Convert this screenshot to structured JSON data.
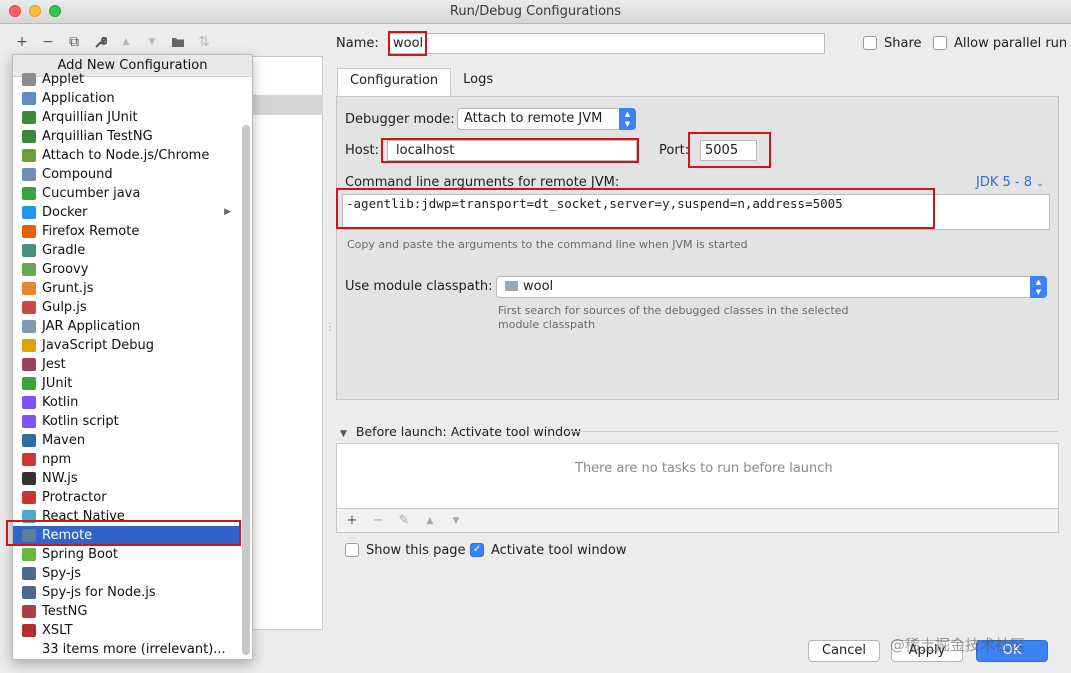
{
  "window": {
    "title": "Run/Debug Configurations"
  },
  "toolbar": {
    "add": "+",
    "remove": "−",
    "copy": "⧉",
    "edit": "🔧",
    "up": "▲",
    "down": "▼",
    "folder": "▣",
    "sort": "⇅"
  },
  "popup": {
    "title": "Add New Configuration",
    "items": [
      {
        "label": "Applet",
        "icon": "applet-icon",
        "color": "#8c8c8c"
      },
      {
        "label": "Application",
        "icon": "application-icon",
        "color": "#5e8ec7"
      },
      {
        "label": "Arquillian JUnit",
        "icon": "arquillian-icon",
        "color": "#3a8a3a"
      },
      {
        "label": "Arquillian TestNG",
        "icon": "arquillian-icon",
        "color": "#3a8a3a"
      },
      {
        "label": "Attach to Node.js/Chrome",
        "icon": "node-icon",
        "color": "#6b9e3a"
      },
      {
        "label": "Compound",
        "icon": "compound-icon",
        "color": "#6d8fb5"
      },
      {
        "label": "Cucumber java",
        "icon": "cucumber-icon",
        "color": "#3aa33a"
      },
      {
        "label": "Docker",
        "icon": "docker-icon",
        "color": "#2496ed"
      },
      {
        "label": "Firefox Remote",
        "icon": "firefox-icon",
        "color": "#e66000"
      },
      {
        "label": "Gradle",
        "icon": "gradle-icon",
        "color": "#4a8f7f"
      },
      {
        "label": "Groovy",
        "icon": "groovy-icon",
        "color": "#6aa84f"
      },
      {
        "label": "Grunt.js",
        "icon": "grunt-icon",
        "color": "#e48632"
      },
      {
        "label": "Gulp.js",
        "icon": "gulp-icon",
        "color": "#cf4646"
      },
      {
        "label": "JAR Application",
        "icon": "jar-icon",
        "color": "#7e9bb5"
      },
      {
        "label": "JavaScript Debug",
        "icon": "js-debug-icon",
        "color": "#d9a400"
      },
      {
        "label": "Jest",
        "icon": "jest-icon",
        "color": "#99425b"
      },
      {
        "label": "JUnit",
        "icon": "junit-icon",
        "color": "#3aa33a"
      },
      {
        "label": "Kotlin",
        "icon": "kotlin-icon",
        "color": "#7f52ff"
      },
      {
        "label": "Kotlin script",
        "icon": "kotlin-script-icon",
        "color": "#7f52ff"
      },
      {
        "label": "Maven",
        "icon": "maven-icon",
        "color": "#2f6ea5"
      },
      {
        "label": "npm",
        "icon": "npm-icon",
        "color": "#cb3837"
      },
      {
        "label": "NW.js",
        "icon": "nwjs-icon",
        "color": "#333333"
      },
      {
        "label": "Protractor",
        "icon": "protractor-icon",
        "color": "#cc3333"
      },
      {
        "label": "React Native",
        "icon": "react-icon",
        "color": "#4fa8c8"
      },
      {
        "label": "Remote",
        "icon": "remote-icon",
        "color": "#5f7c99"
      },
      {
        "label": "Spring Boot",
        "icon": "spring-icon",
        "color": "#6db33f"
      },
      {
        "label": "Spy-js",
        "icon": "spyjs-icon",
        "color": "#4a6a8a"
      },
      {
        "label": "Spy-js for Node.js",
        "icon": "spyjs-node-icon",
        "color": "#4a6a8a"
      },
      {
        "label": "TestNG",
        "icon": "testng-icon",
        "color": "#b04040"
      },
      {
        "label": "XSLT",
        "icon": "xslt-icon",
        "color": "#b03030"
      },
      {
        "label": "33 items more (irrelevant)...",
        "icon": "",
        "color": ""
      }
    ],
    "selected": "Remote"
  },
  "form": {
    "name_label": "Name:",
    "name_value": "wool",
    "share_label": "Share",
    "parallel_label": "Allow parallel run",
    "tabs": [
      "Configuration",
      "Logs"
    ],
    "debugger_mode_label": "Debugger mode:",
    "debugger_mode_value": "Attach to remote JVM",
    "host_label": "Host:",
    "host_value": "localhost",
    "port_label": "Port:",
    "port_value": "5005",
    "cmd_label": "Command line arguments for remote JVM:",
    "jdk_label": "JDK 5 - 8",
    "cmd_value": "-agentlib:jdwp=transport=dt_socket,server=y,suspend=n,address=5005",
    "cmd_hint": "Copy and paste the arguments to the command line when JVM is started",
    "module_label": "Use module classpath:",
    "module_value": "wool",
    "module_hint_1": "First search for sources of the debugged classes in the selected",
    "module_hint_2": "module classpath"
  },
  "before_launch": {
    "header": "Before launch: Activate tool window",
    "empty_text": "There are no tasks to run before launch",
    "show_page_label": "Show this page",
    "activate_label": "Activate tool window",
    "show_page_checked": false,
    "activate_checked": true
  },
  "buttons": {
    "cancel": "Cancel",
    "apply": "Apply",
    "ok": "OK"
  },
  "watermark": "@稀土掘金技术社区",
  "colors": {
    "selection": "#2f65ca",
    "accent": "#3b82f6",
    "highlight_box": "#d0141c"
  }
}
